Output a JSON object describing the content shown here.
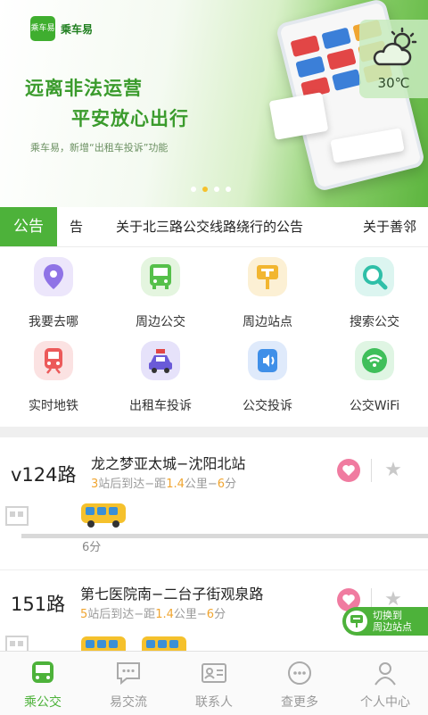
{
  "banner": {
    "logo_text": "乘车易",
    "brand_name": "乘车易",
    "slogan_line1": "远离非法运营",
    "slogan_line2": "平安放心出行",
    "tagline": "乘车易，新增“出租车投诉”功能",
    "weather_temp": "30℃",
    "weather_icon": "partly-cloudy-icon",
    "carousel_dots": 4,
    "carousel_active": 2
  },
  "notice": {
    "label": "公告",
    "items": [
      "告",
      "关于北三路公交线路绕行的公告",
      "关于善邻"
    ]
  },
  "services": [
    {
      "label": "我要去哪",
      "icon": "location-pin-icon",
      "color": "#8f73e6"
    },
    {
      "label": "周边公交",
      "icon": "bus-icon",
      "color": "#55c04a"
    },
    {
      "label": "周边站点",
      "icon": "bus-stop-sign-icon",
      "color": "#f2b630"
    },
    {
      "label": "搜索公交",
      "icon": "search-icon",
      "color": "#2fbfa8"
    },
    {
      "label": "实时地铁",
      "icon": "subway-icon",
      "color": "#ec5a5a"
    },
    {
      "label": "出租车投诉",
      "icon": "taxi-icon",
      "color": "#6a5ad8"
    },
    {
      "label": "公交投诉",
      "icon": "speaker-icon",
      "color": "#3f8fe8"
    },
    {
      "label": "公交WiFi",
      "icon": "wifi-icon",
      "color": "#3fbf5a"
    }
  ],
  "routes": [
    {
      "number": "v124路",
      "destination": "龙之梦亚太城−沈阳北站",
      "stops": "3",
      "stops_suffix": "站后到达−距",
      "distance": "1.4",
      "dist_suffix": "公里−",
      "minutes": "6",
      "min_suffix": "分",
      "bus_eta": "6分"
    },
    {
      "number": "151路",
      "destination": "第七医院南−二台子街观泉路",
      "stops": "5",
      "stops_suffix": "站后到达−距",
      "distance": "1.4",
      "dist_suffix": "公里−",
      "minutes": "6",
      "min_suffix": "分"
    }
  ],
  "switch_button": {
    "line1": "切换到",
    "line2": "周边站点"
  },
  "tabs": [
    {
      "label": "乘公交",
      "icon": "bus-tab-icon",
      "active": true
    },
    {
      "label": "易交流",
      "icon": "chat-icon",
      "active": false
    },
    {
      "label": "联系人",
      "icon": "contact-card-icon",
      "active": false
    },
    {
      "label": "查更多",
      "icon": "more-icon",
      "active": false
    },
    {
      "label": "个人中心",
      "icon": "user-icon",
      "active": false
    }
  ],
  "colors": {
    "accent": "#4db23a",
    "highlight": "#f0a531",
    "favorite": "#f07ba0"
  }
}
